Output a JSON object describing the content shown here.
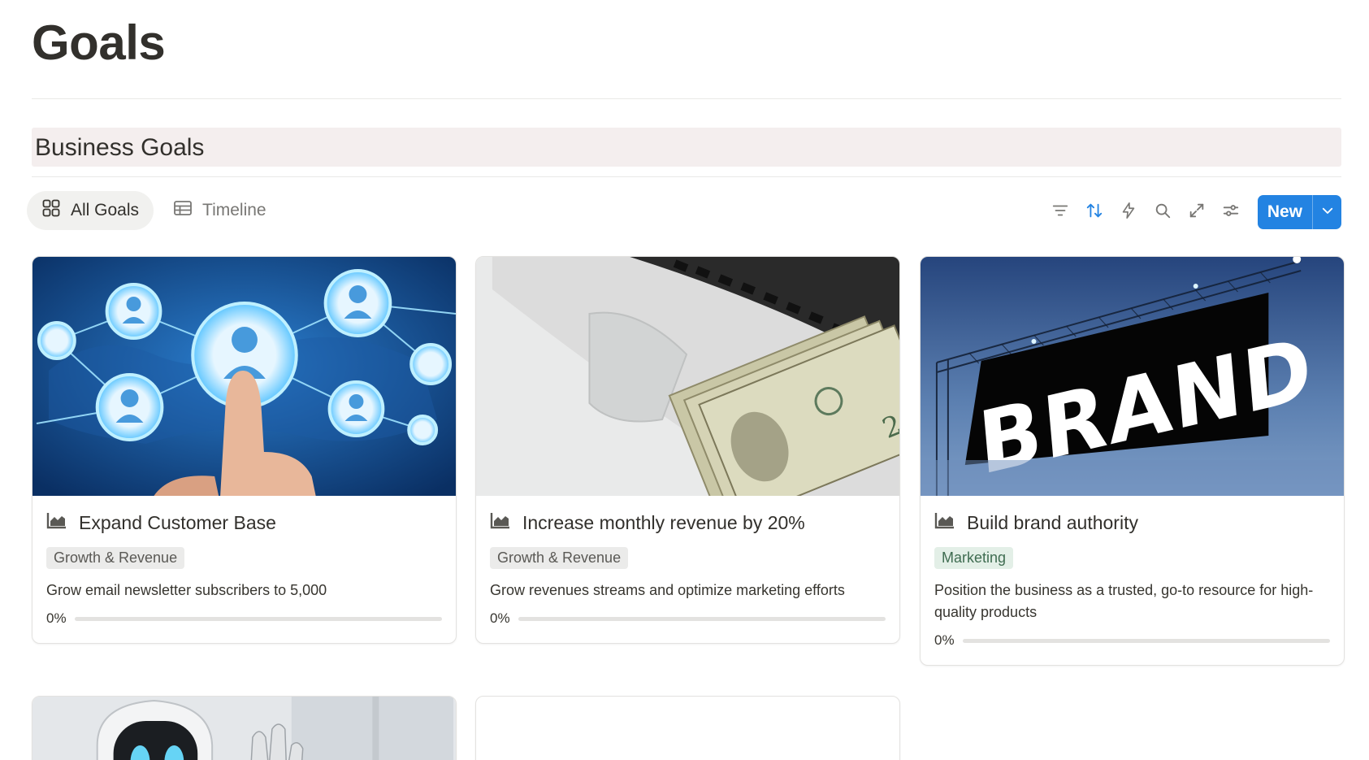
{
  "page": {
    "title": "Goals"
  },
  "section": {
    "title": "Business Goals"
  },
  "views": [
    {
      "label": "All Goals",
      "icon": "gallery-icon",
      "active": true
    },
    {
      "label": "Timeline",
      "icon": "table-icon",
      "active": false
    }
  ],
  "toolbar": {
    "tools": [
      "filter-icon",
      "sort-icon",
      "lightning-icon",
      "search-icon",
      "expand-icon",
      "settings-sliders-icon"
    ],
    "new_label": "New",
    "accent": "#2383e2"
  },
  "cards": [
    {
      "title": "Expand Customer Base",
      "tag": "Growth & Revenue",
      "tag_bg": "#ebebea",
      "tag_color": "#5a5955",
      "description": "Grow email newsletter subscribers to 5,000",
      "progress_label": "0%",
      "progress": 0,
      "image": "network-people-image"
    },
    {
      "title": "Increase monthly revenue by 20%",
      "tag": "Growth & Revenue",
      "tag_bg": "#ebebea",
      "tag_color": "#5a5955",
      "description": "Grow revenues streams and optimize marketing efforts",
      "progress_label": "0%",
      "progress": 0,
      "image": "money-laptop-image"
    },
    {
      "title": "Build brand authority",
      "tag": "Marketing",
      "tag_bg": "#e3efe7",
      "tag_color": "#3f6c51",
      "description": "Position the business as a trusted, go-to resource for high-quality products",
      "progress_label": "0%",
      "progress": 0,
      "image": "brand-sign-image",
      "image_text": "BRAND"
    }
  ]
}
